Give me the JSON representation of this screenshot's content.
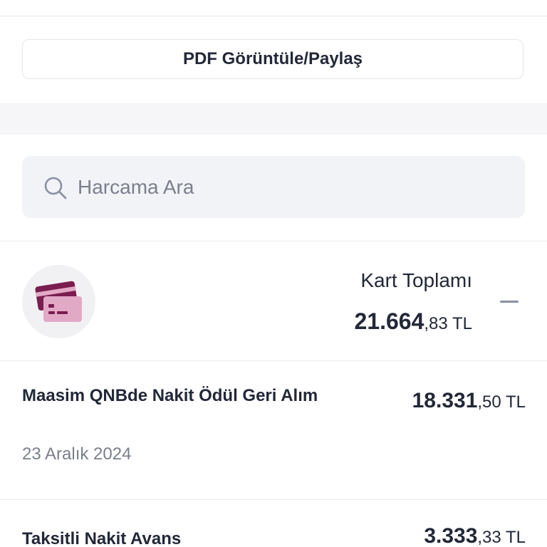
{
  "pdf_button": {
    "label": "PDF Görüntüle/Paylaş"
  },
  "search": {
    "placeholder": "Harcama Ara",
    "value": ""
  },
  "card_summary": {
    "icon": "credit-card-icon",
    "label": "Kart Toplamı",
    "amount_int": "21.664",
    "amount_dec": ",83 TL"
  },
  "transactions": [
    {
      "title": "Maasim QNBde Nakit Ödül Geri Alım",
      "date": "23 Aralık 2024",
      "amount_int": "18.331",
      "amount_dec": ",50 TL"
    },
    {
      "title": "Taksitli Nakit Avans",
      "amount_int": "3.333",
      "amount_dec": ",33 TL"
    }
  ],
  "colors": {
    "card_icon_dark": "#7a1d4f",
    "card_icon_light": "#e2a9c7"
  }
}
